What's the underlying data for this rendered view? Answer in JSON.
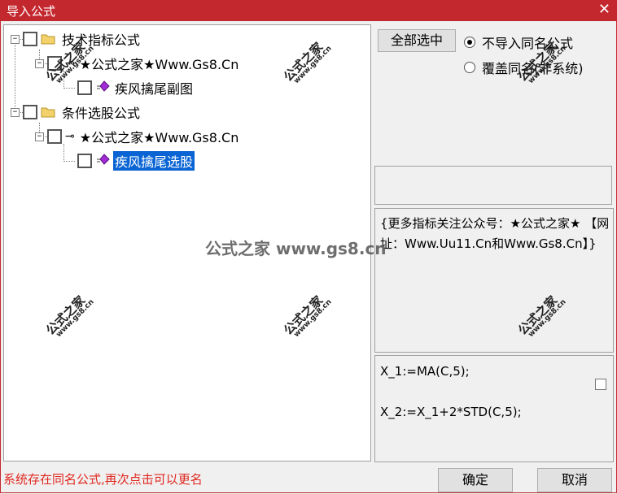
{
  "window": {
    "title": "导入公式",
    "close_glyph": "✕",
    "accent_color": "#c4282f"
  },
  "tree": {
    "groups": [
      {
        "label": "技术指标公式",
        "expander": "−",
        "child": {
          "label": "★公式之家★Www.Gs8.Cn",
          "expander": "−",
          "icon": "key-icon",
          "leaf": {
            "label": "疾风擒尾副图",
            "icon": "gem-icon",
            "selected": false
          }
        }
      },
      {
        "label": "条件选股公式",
        "expander": "−",
        "child": {
          "label": "★公式之家★Www.Gs8.Cn",
          "expander": "−",
          "icon": "key-icon",
          "leaf": {
            "label": "疾风擒尾选股",
            "icon": "gem-icon",
            "selected": true
          }
        }
      }
    ]
  },
  "options": {
    "select_all_label": "全部选中",
    "radio_no_import": "不导入同名公式",
    "radio_overwrite": "覆盖同名(非系统)",
    "selected": "no_import"
  },
  "note": {
    "text": "{更多指标关注公众号：★公式之家★ 【网址：Www.Uu11.Cn和Www.Gs8.Cn】}"
  },
  "code": {
    "line1": "X_1:=MA(C,5);",
    "line2": "X_2:=X_1+2*STD(C,5);"
  },
  "status": {
    "message": "系统存在同名公式,再次点击可以更名",
    "color": "#e0281f"
  },
  "buttons": {
    "ok": "确定",
    "cancel": "取消"
  },
  "watermark": {
    "small_top": "公式之家",
    "small_bottom": "www.gs8.cn",
    "center": "公式之家 www.gs8.cn"
  }
}
